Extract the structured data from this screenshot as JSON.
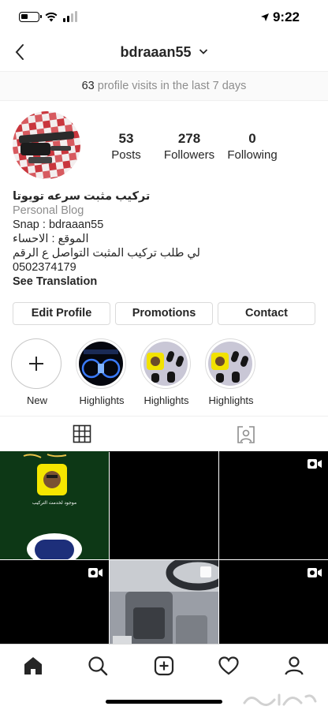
{
  "status": {
    "time": "9:22"
  },
  "header": {
    "username": "bdraaan55"
  },
  "visits": {
    "count": "63",
    "text": " profile visits in the last 7 days"
  },
  "stats": [
    {
      "value": "53",
      "label": "Posts"
    },
    {
      "value": "278",
      "label": "Followers"
    },
    {
      "value": "0",
      "label": "Following"
    }
  ],
  "bio": {
    "name": "تركيب مثبت سرعه تويوتا",
    "category": "Personal Blog",
    "lines": [
      "Snap : bdraaan55",
      "الموقع : الاحساء",
      "لي طلب تركيب المثبت التواصل ع الرقم",
      "0502374179"
    ],
    "see_translation": "See Translation"
  },
  "buttons": {
    "edit": "Edit Profile",
    "promotions": "Promotions",
    "contact": "Contact"
  },
  "highlights": [
    {
      "label": "New"
    },
    {
      "label": "Highlights"
    },
    {
      "label": "Highlights"
    },
    {
      "label": "Highlights"
    }
  ],
  "grid": {
    "snap_caption": "موجود لخدمت التركيب"
  },
  "icons": {
    "back": "chevron-left-icon",
    "dropdown": "chevron-down-icon",
    "grid_tab": "grid-icon",
    "tagged_tab": "tagged-person-icon",
    "video": "video-camera-icon",
    "nav": [
      "home-icon",
      "search-icon",
      "add-post-icon",
      "heart-icon",
      "profile-icon"
    ]
  },
  "colors": {
    "text": "#262626",
    "muted": "#8e8e8e",
    "border": "#dbdbdb"
  }
}
